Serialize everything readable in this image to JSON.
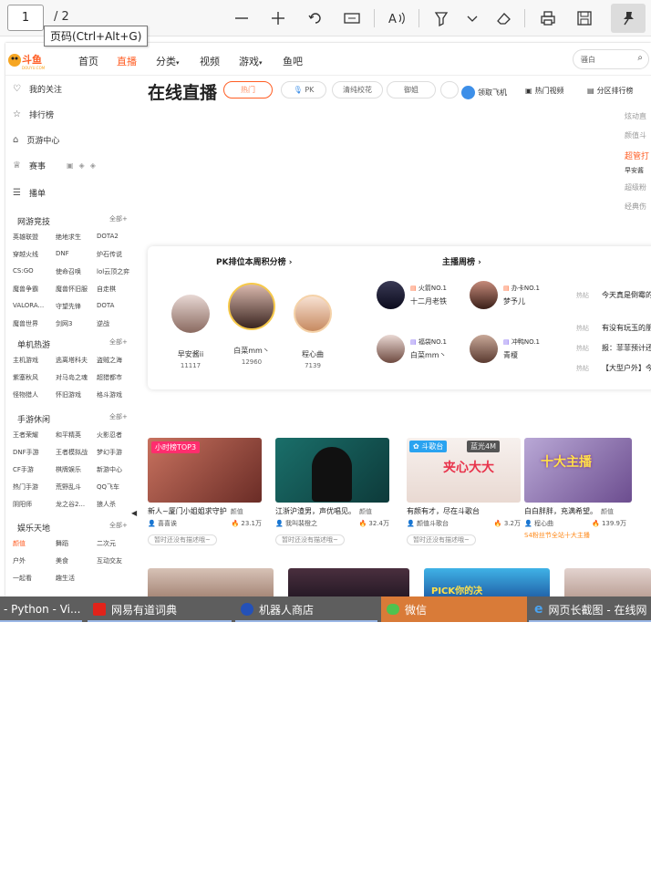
{
  "viewer": {
    "page_current": "1",
    "page_total": "/ 2",
    "tooltip": "页码(Ctrl+Alt+G)"
  },
  "topnav": {
    "logo_text": "斗鱼",
    "logo_sub": "DOUYU.COM",
    "items": [
      "首页",
      "直播",
      "分类",
      "视频",
      "游戏",
      "鱼吧"
    ],
    "active": "直播",
    "search_placeholder": "骚白"
  },
  "sidebar": {
    "main": [
      "我的关注",
      "排行榜",
      "页游中心",
      "赛事",
      "播单"
    ],
    "sections": [
      {
        "title": "网游竞技",
        "all": "全部+",
        "items": [
          "英雄联盟",
          "绝地求生",
          "DOTA2",
          "穿越火线",
          "DNF",
          "炉石传说",
          "CS:GO",
          "使命召唤",
          "lol云顶之弈",
          "魔兽争霸",
          "魔兽怀旧服",
          "自走棋",
          "VALORA...",
          "守望先锋",
          "DOTA",
          "魔兽世界",
          "剑网3",
          "逆战"
        ]
      },
      {
        "title": "单机热游",
        "all": "全部+",
        "items": [
          "主机游戏",
          "逃离塔科夫",
          "盗贼之海",
          "紫塞秋风",
          "对马岛之魂",
          "超猎都市",
          "怪物猎人",
          "怀旧游戏",
          "格斗游戏"
        ]
      },
      {
        "title": "手游休闲",
        "all": "全部+",
        "items": [
          "王者荣耀",
          "和平精英",
          "火影忍者",
          "DNF手游",
          "王者模拟战",
          "梦幻手游",
          "CF手游",
          "棋牌娱乐",
          "新游中心",
          "热门手游",
          "荒野乱斗",
          "QQ飞车",
          "阴阳师",
          "龙之谷2...",
          "狼人杀"
        ]
      },
      {
        "title": "娱乐天地",
        "all": "全部+",
        "items": [
          "颜值",
          "舞蹈",
          "二次元",
          "户外",
          "美食",
          "互动交友",
          "一起看",
          "趣生活"
        ]
      }
    ]
  },
  "main": {
    "title": "在线直播",
    "pills": [
      "热门",
      "PK",
      "清纯校花",
      "御姐"
    ],
    "links": [
      "领取飞机",
      "热门视频",
      "分区排行榜"
    ],
    "right_col": [
      "炫动直",
      "颜值斗",
      "超管打",
      "早安酱",
      "超级粉",
      "经典伤"
    ],
    "pk": {
      "title": "PK排位本周积分榜",
      "users": [
        {
          "name": "早安酱ii",
          "score": "11117"
        },
        {
          "name": "白菜mm丶",
          "score": "12960"
        },
        {
          "name": "程心曲",
          "score": "7139"
        }
      ]
    },
    "weekly": {
      "title": "主播周榜",
      "hosts": [
        {
          "badge": "火箭NO.1",
          "name": "十二月老铁"
        },
        {
          "badge": "办卡NO.1",
          "name": "梦予儿"
        },
        {
          "badge": "福袋NO.1",
          "name": "白菜mm丶"
        },
        {
          "badge": "冲鸭NO.1",
          "name": "青榎"
        }
      ]
    },
    "hot": [
      {
        "tag": "热帖",
        "text": "今天真是倒霉的"
      },
      {
        "tag": "热帖",
        "text": "有没有玩玉的朋"
      },
      {
        "tag": "热帖",
        "text": "报：菲菲预计还"
      },
      {
        "tag": "热帖",
        "text": "【大型户外】今"
      }
    ],
    "videos": [
      {
        "badge": "小时榜TOP3",
        "title": "新人~厦门小姐姐求守护",
        "cat": "颜值",
        "author": "喜喜诶",
        "heat": "23.1万",
        "desc": "暂时还没有描述哦~"
      },
      {
        "badge": "",
        "title": "江浙沪渣男，声优唱见。",
        "cat": "颜值",
        "author": "我叫裴橙之",
        "heat": "32.4万",
        "desc": "暂时还没有描述哦~"
      },
      {
        "badge": "斗歌台",
        "title": "有颜有才，尽在斗歌台",
        "cat": "",
        "author": "颜值斗歌台",
        "heat": "3.2万",
        "desc": "暂时还没有描述哦~",
        "thumb_text": "夹心大大",
        "thumb_tag": "蓝光4M"
      },
      {
        "badge": "",
        "title": "白白胖胖，充满希望。",
        "cat": "颜值",
        "author": "程心曲",
        "heat": "139.9万",
        "desc": "",
        "extra": "S4粉丝节全站十大主播",
        "thumb_text": "十大主播"
      }
    ],
    "row2_text": "PICK你的决"
  },
  "taskbar": {
    "items": [
      {
        "label": "- Python - Vi..."
      },
      {
        "label": "网易有道词典"
      },
      {
        "label": "机器人商店"
      },
      {
        "label": "微信"
      },
      {
        "label": "网页长截图 - 在线网"
      }
    ],
    "active": "微信"
  }
}
